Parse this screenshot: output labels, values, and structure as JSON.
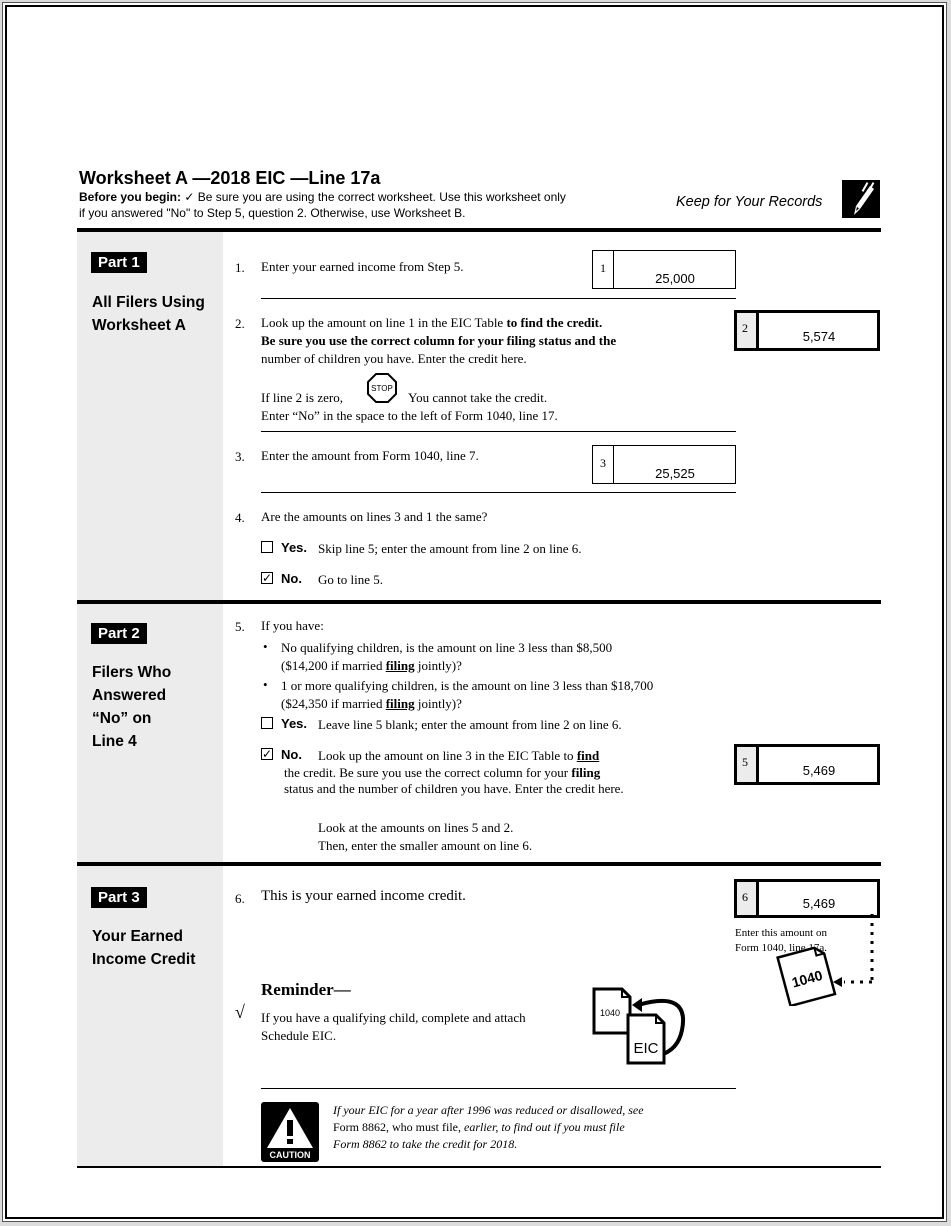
{
  "header": {
    "title": "Worksheet A —2018 EIC —Line 17a",
    "before_label": "Before you begin:",
    "before_text_1": "✓ Be sure you are using the correct worksheet. Use this worksheet only",
    "before_text_2": "if you answered \"No\" to Step 5, question 2. Otherwise, use Worksheet B.",
    "keep_records": "Keep for Your Records",
    "icon": "pencil-icon"
  },
  "parts": [
    {
      "tag": "Part 1",
      "title_lines": [
        "All Filers Using",
        "Worksheet A"
      ]
    },
    {
      "tag": "Part 2",
      "title_lines": [
        "Filers Who",
        "Answered",
        "“No” on",
        "Line 4"
      ]
    },
    {
      "tag": "Part 3",
      "title_lines": [
        "Your Earned",
        "Income Credit"
      ]
    }
  ],
  "lines": {
    "l1": {
      "num": "1.",
      "text": "Enter your earned income from Step 5.",
      "box_label": "1",
      "value": "25,000"
    },
    "l2": {
      "num": "2.",
      "text_a": "Look up the amount on line 1 in the EIC Table ",
      "text_a_bold": "to find the credit.",
      "text_b_bold": "Be sure you use the correct column for your filing status and the",
      "text_c": "number of children you have. Enter the credit here.",
      "zero_a": "If line 2 is zero,",
      "stop": "STOP",
      "zero_b": "You cannot take the credit.",
      "zero_c": "Enter “No” in the space to the left of Form 1040, line 17.",
      "box_label": "2",
      "value": "5,574"
    },
    "l3": {
      "num": "3.",
      "text": "Enter the amount from Form 1040, line 7.",
      "box_label": "3",
      "value": "25,525"
    },
    "l4": {
      "num": "4.",
      "text": "Are the amounts on lines 3 and 1 the same?",
      "yes_word": "Yes.",
      "yes_text": "Skip line 5; enter the amount from line 2 on line 6.",
      "yes_checked": false,
      "no_word": "No.",
      "no_text": "Go to line 5.",
      "no_checked": true
    },
    "l5": {
      "num": "5.",
      "text": "If you have:",
      "bullet1_a": "No qualifying children, is the amount on line 3 less than $8,500",
      "bullet1_b": "($14,200 if married ",
      "bullet1_bold": "filing",
      "bullet1_c": " jointly)?",
      "bullet2_a": "1 or more qualifying children, is the amount on line 3 less than $18,700",
      "bullet2_b": "($24,350 if married ",
      "bullet2_bold": "filing",
      "bullet2_c": " jointly)?",
      "yes_word": "Yes.",
      "yes_text": "Leave line 5 blank; enter the amount from line 2 on line 6.",
      "yes_checked": false,
      "no_word": "No.",
      "no_text_a": "Look up the amount on line 3 in the EIC Table to ",
      "no_text_a_bold": "find",
      "no_text_b": "the credit. Be sure you use the correct column for your ",
      "no_text_b_bold": "filing",
      "no_text_c": "status and the number of children you have. Enter the credit here.",
      "no_checked": true,
      "look_a": "Look at the amounts on lines 5 and 2.",
      "look_b": "Then, enter the smaller amount on line 6.",
      "box_label": "5",
      "value": "5,469"
    },
    "l6": {
      "num": "6.",
      "text": "This is your earned income credit.",
      "box_label": "6",
      "value": "5,469",
      "enter_a": "Enter this amount on",
      "enter_b": "Form 1040, line 17a.",
      "form_icon_label": "1040"
    }
  },
  "reminder": {
    "title": "Reminder—",
    "check": "√",
    "text_a": "If you have a qualifying child, complete and attach",
    "text_b": "Schedule EIC.",
    "doc1": "1040",
    "doc2": "EIC"
  },
  "caution": {
    "label": "CAUTION",
    "text_a": "If your EIC for a year after 1996 was reduced or disallowed, see",
    "text_b": "Form 8862, who must file, ",
    "text_b_italic": "earlier, to find out if you must file",
    "text_c": "Form 8862 to take the credit for 2018."
  }
}
